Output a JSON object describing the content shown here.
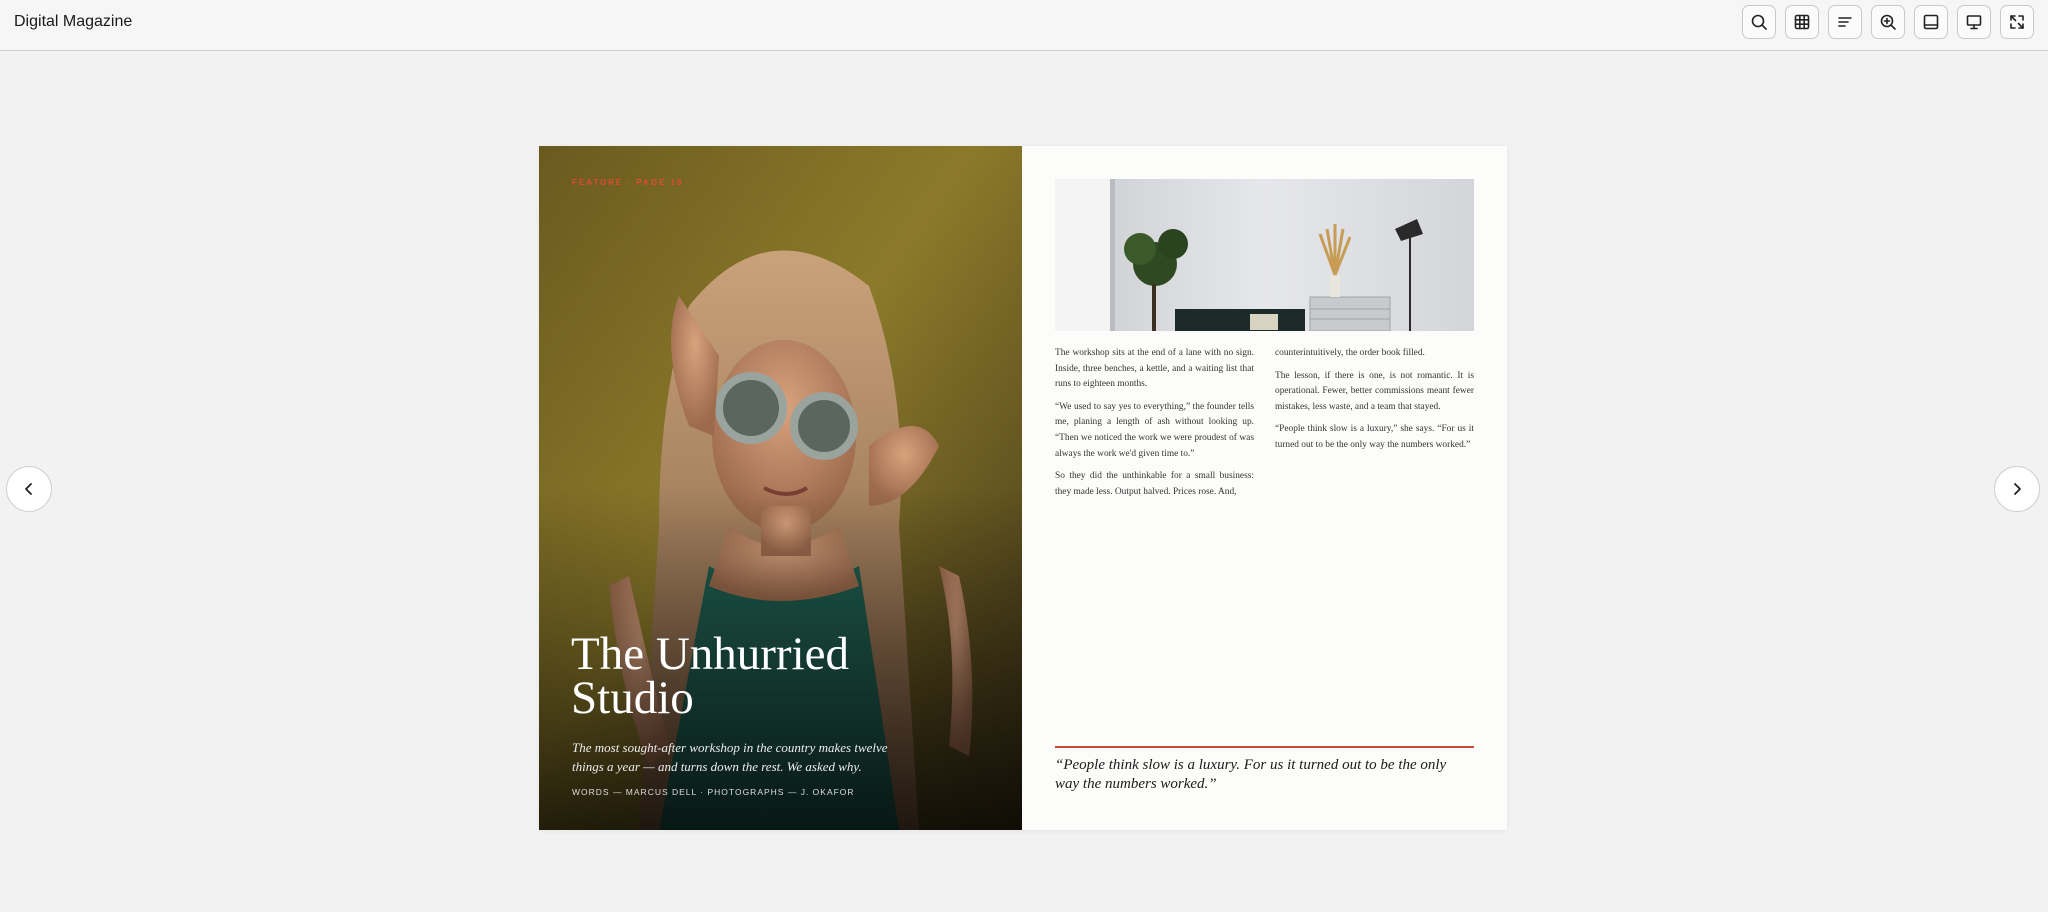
{
  "app": {
    "title": "Digital Magazine"
  },
  "toolbar": [
    {
      "name": "search-button",
      "icon": "search-icon"
    },
    {
      "name": "grid-view-button",
      "icon": "grid-icon"
    },
    {
      "name": "contents-button",
      "icon": "list-icon"
    },
    {
      "name": "zoom-button",
      "icon": "zoom-in-icon"
    },
    {
      "name": "single-page-button",
      "icon": "page-layout-icon"
    },
    {
      "name": "presentation-button",
      "icon": "presentation-icon"
    },
    {
      "name": "fullscreen-button",
      "icon": "fullscreen-icon"
    }
  ],
  "feature": {
    "eyebrow": "FEATURE · PAGE 18",
    "title_line1": "The Unhurried",
    "title_line2": "Studio",
    "dek": "The most sought-after workshop in the country makes twelve things a year — and turns down the rest. We asked why.",
    "credits": "WORDS — MARCUS DELL · PHOTOGRAPHS — J. OKAFOR"
  },
  "article": {
    "col1": [
      "The workshop sits at the end of a lane with no sign. Inside, three benches, a kettle, and a waiting list that runs to eighteen months.",
      "“We used to say yes to everything,” the founder tells me, planing a length of ash without looking up. “Then we noticed the work we were proudest of was always the work we'd given time to.”",
      "So they did the unthinkable for a small business: they made less. Output halved. Prices rose. And,"
    ],
    "col2": [
      "counterintuitively, the order book filled.",
      "The lesson, if there is one, is not romantic. It is operational. Fewer, better commissions meant fewer mistakes, less waste, and a team that stayed.",
      "“People think slow is a luxury,” she says. “For us it turned out to be the only way the numbers worked.”"
    ],
    "pullquote": "“People think slow is a luxury. For us it turned out to be the only way the numbers worked.”"
  },
  "nav": {
    "prev": "chevron-left-icon",
    "next": "chevron-right-icon"
  },
  "colors": {
    "accent": "#c9483b",
    "eyebrow": "#e04a33"
  }
}
